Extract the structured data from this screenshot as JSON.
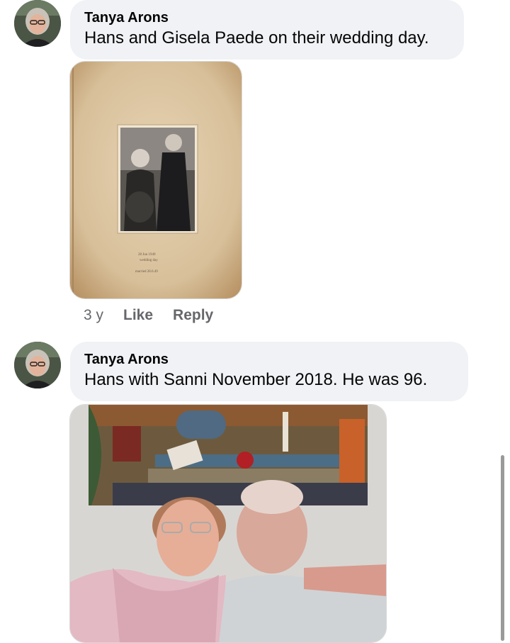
{
  "comments": [
    {
      "author": "Tanya Arons",
      "text": "Hans and Gisela Paede on their wedding day.",
      "photo_alt": "wedding-photo",
      "time": "3 y",
      "like_label": "Like",
      "reply_label": "Reply"
    },
    {
      "author": "Tanya Arons",
      "text": "Hans with Sanni November 2018.  He was 96.",
      "photo_alt": "couple-photo"
    }
  ],
  "colors": {
    "bubble": "#f0f2f5",
    "secondary_text": "#65676b",
    "paper": "#d9c3a1"
  }
}
